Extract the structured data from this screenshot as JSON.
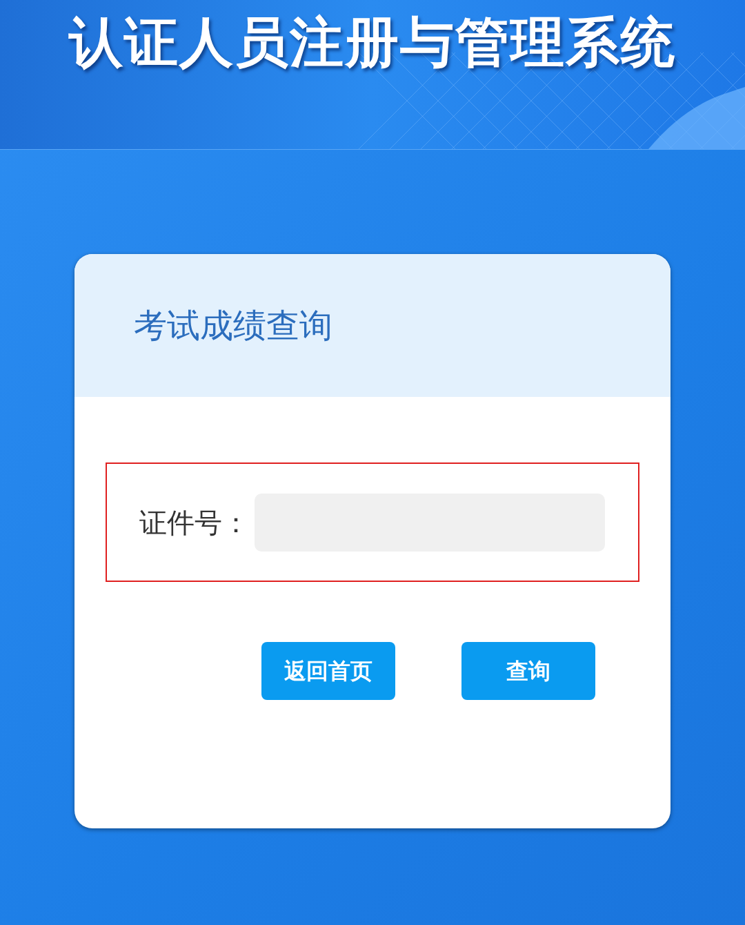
{
  "header": {
    "title": "认证人员注册与管理系统"
  },
  "card": {
    "title": "考试成绩查询",
    "field": {
      "label": "证件号：",
      "highlighted": true
    },
    "buttons": [
      {
        "label": "返回首页"
      },
      {
        "label": "查询"
      }
    ]
  }
}
